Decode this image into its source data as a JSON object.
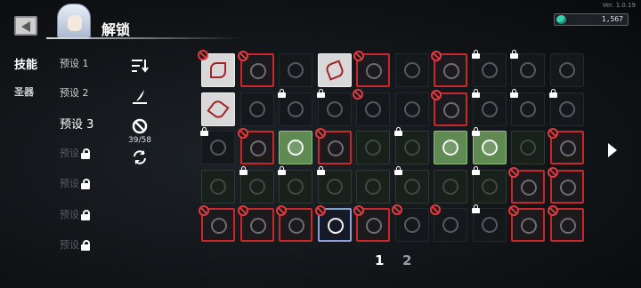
{
  "header": {
    "title": "解锁",
    "version": "Ver. 1.0.19",
    "currency_value": "1,567",
    "currency_icon": "gem-icon"
  },
  "categories": [
    {
      "label": "技能",
      "active": true
    },
    {
      "label": "圣器",
      "active": false
    }
  ],
  "presets": [
    {
      "label": "预设 1",
      "locked": false
    },
    {
      "label": "预设 2",
      "locked": false
    },
    {
      "label": "预设 3",
      "locked": false,
      "active": true
    },
    {
      "label": "预设",
      "locked": true
    },
    {
      "label": "预设",
      "locked": true
    },
    {
      "label": "预设",
      "locked": true
    },
    {
      "label": "预设",
      "locked": true
    }
  ],
  "tools": {
    "sort_icon": "sort-icon",
    "edit_icon": "quill-icon",
    "ban_icon": "ban-icon",
    "ban_count": "39/58",
    "reset_icon": "refresh-icon"
  },
  "skills_grid": {
    "rows": [
      [
        "white-ban",
        "red-ban",
        "dark",
        "white",
        "red-ban",
        "dark",
        "red-ban",
        "dark-lock",
        "dark-lock",
        "dark"
      ],
      [
        "white",
        "dark",
        "dark-lock",
        "dark-lock",
        "dark-ban",
        "dark",
        "red-ban",
        "dark-lock",
        "dark-lock",
        "dark-lock"
      ],
      [
        "dark-lock",
        "red-ban",
        "green",
        "red-ban",
        "dkgreen",
        "dkgreen-lock",
        "green",
        "green-lock",
        "dkgreen",
        "red-ban"
      ],
      [
        "dkgreen",
        "dkgreen-lock",
        "dkgreen-lock",
        "dkgreen-lock",
        "dkgreen",
        "dkgreen-lock",
        "dkgreen",
        "dkgreen-lock",
        "red-ban",
        "red-ban"
      ],
      [
        "red-ban",
        "red-ban",
        "red-ban",
        "blue-ban",
        "red-ban",
        "dark-ban",
        "dark-ban",
        "dark-lock",
        "red-ban",
        "red-ban"
      ]
    ]
  },
  "pagination": {
    "pages": [
      "1",
      "2"
    ],
    "current": "1"
  },
  "colors": {
    "ban_red": "#c8272b",
    "unlocked_green": "#5f8a52",
    "selected_blue": "#8da3d6"
  }
}
